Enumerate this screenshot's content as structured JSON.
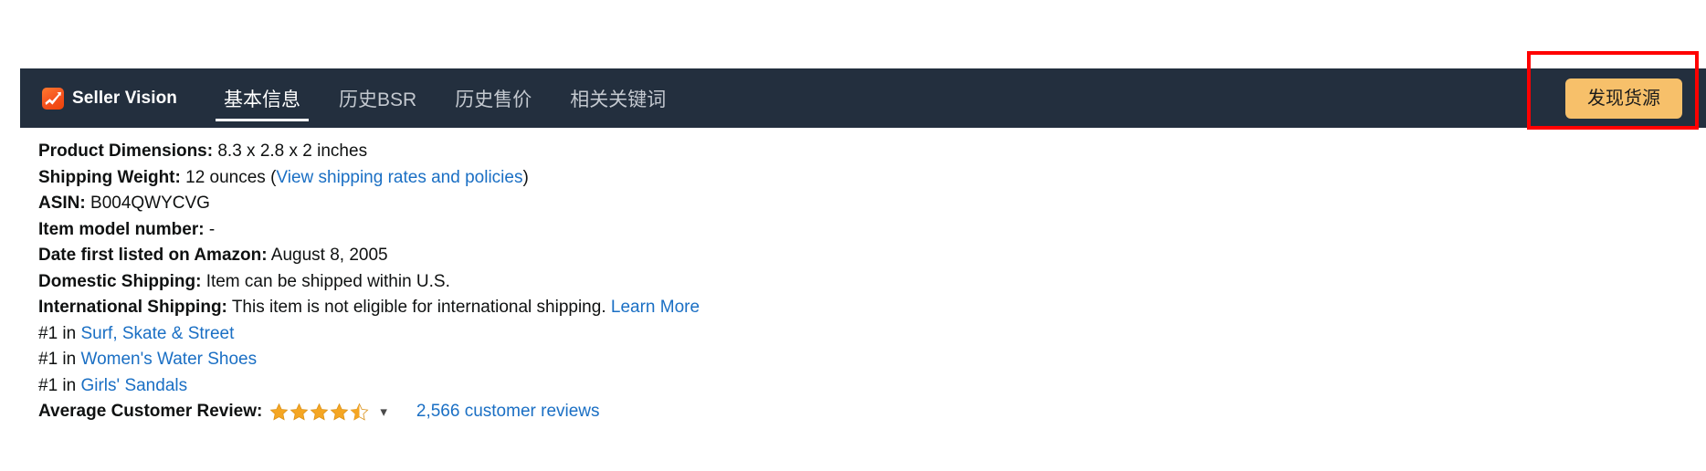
{
  "navbar": {
    "brand": {
      "name": "Seller Vision",
      "logo_icon": "seller-vision-logo-icon"
    },
    "tabs": [
      {
        "label": "基本信息",
        "active": true
      },
      {
        "label": "历史BSR",
        "active": false
      },
      {
        "label": "历史售价",
        "active": false
      },
      {
        "label": "相关关键词",
        "active": false
      }
    ],
    "cta_label": "发现货源",
    "colors": {
      "bar_background": "#232f3e",
      "cta_background": "#f7c06a",
      "cta_text": "#1b1b1b",
      "tab_active_text": "#ffffff",
      "tab_inactive_text": "#c3c8cf",
      "annotation_border": "#ff0000"
    }
  },
  "details": {
    "rows": [
      {
        "label": "Product Dimensions:",
        "value": "8.3 x 2.8 x 2 inches"
      },
      {
        "label": "Shipping Weight:",
        "value": "12 ounces",
        "link_open": "(",
        "link_text": "View shipping rates and policies",
        "link_close": ")"
      },
      {
        "label": "ASIN:",
        "value": "B004QWYCVG"
      },
      {
        "label": "Item model number:",
        "value": "-"
      },
      {
        "label": "Date first listed on Amazon:",
        "value": "August 8, 2005"
      },
      {
        "label": "Domestic Shipping:",
        "value": "Item can be shipped within U.S."
      },
      {
        "label": "International Shipping:",
        "value": "This item is not eligible for international shipping.",
        "link_text": "Learn More"
      }
    ],
    "ranks": [
      {
        "prefix": "#1 in",
        "category": "Surf, Skate & Street"
      },
      {
        "prefix": "#1 in",
        "category": "Women's Water Shoes"
      },
      {
        "prefix": "#1 in",
        "category": "Girls' Sandals"
      }
    ],
    "review": {
      "label": "Average Customer Review:",
      "rating": 4.5,
      "max_rating": 5,
      "star_color": "#f5a623",
      "chevron_icon": "chevron-down-icon",
      "reviews_link": "2,566 customer reviews"
    }
  }
}
